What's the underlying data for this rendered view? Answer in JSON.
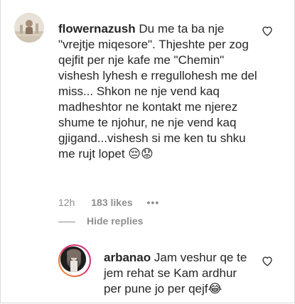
{
  "comment": {
    "username": "flowernazush",
    "text": "Du me ta ba nje \"vrejtje miqesore\". Thjeshte per zog qejfit per nje kafe me \"Chemin\" vishesh lyhesh e rregullohesh me del miss... Shkon ne nje vend kaq madheshtor ne kontakt me njerez shume te njohur, ne nje vend kaq gjigand...vishesh si me ken tu shku me rujt lopet 😔😟",
    "time": "12h",
    "likes": "183 likes",
    "more": "•••"
  },
  "hide_replies_label": "Hide replies",
  "reply": {
    "username": "arbanao",
    "text": "Jam veshur qe te jem rehat se Kam ardhur per pune jo per qejf😂"
  },
  "colors": {
    "text": "#262626",
    "secondary": "#8e8e8e",
    "story_ring_start": "#f5a623",
    "story_ring_end": "#c13584"
  },
  "icons": {
    "like": "heart-outline-icon"
  }
}
